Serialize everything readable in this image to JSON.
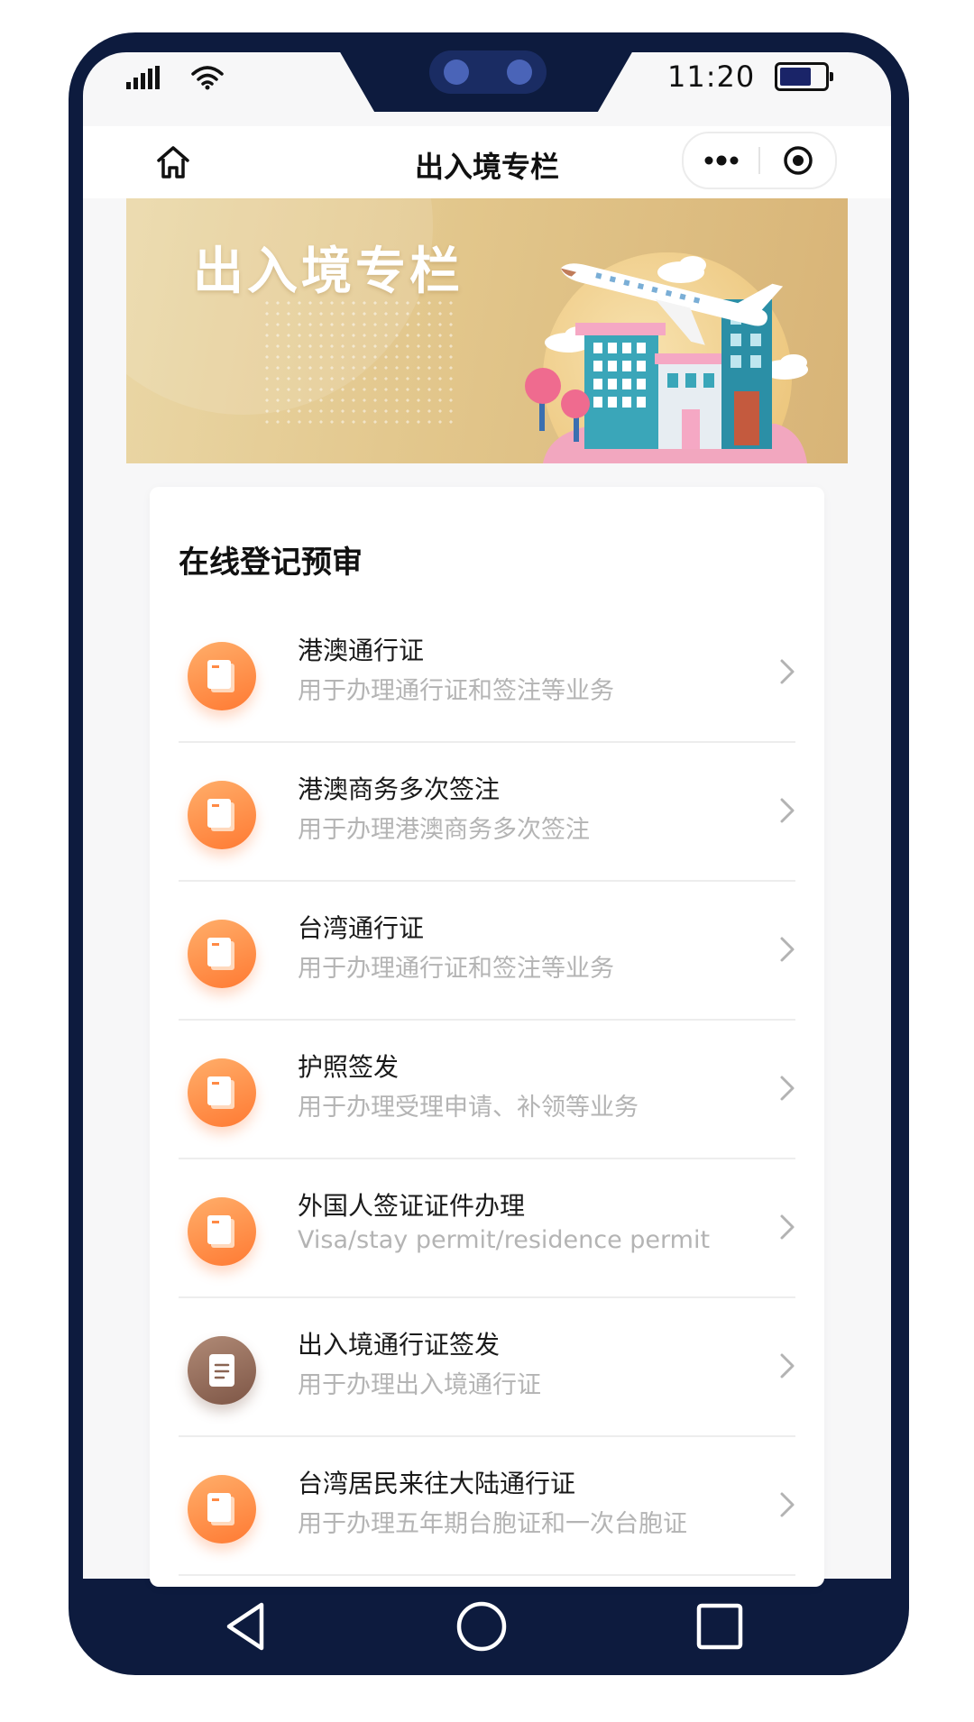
{
  "status_bar": {
    "time": "11:20",
    "icons": [
      "signal-icon",
      "wifi-icon",
      "battery-icon"
    ]
  },
  "navbar": {
    "title": "出入境专栏",
    "icons": [
      "home-icon",
      "more-icon",
      "close-miniprogram-icon"
    ]
  },
  "banner": {
    "title": "出入境专栏",
    "colors": {
      "gold_light": "#ead7a6",
      "gold_dark": "#d8b477"
    }
  },
  "section": {
    "title": "在线登记预审",
    "items": [
      {
        "name": "港澳通行证",
        "desc": "用于办理通行证和签注等业务",
        "icon": "passport-icon"
      },
      {
        "name": "港澳商务多次签注",
        "desc": "用于办理港澳商务多次签注",
        "icon": "passport-icon"
      },
      {
        "name": "台湾通行证",
        "desc": "用于办理通行证和签注等业务",
        "icon": "passport-icon"
      },
      {
        "name": "护照签发",
        "desc": "用于办理受理申请、补领等业务",
        "icon": "passport-icon"
      },
      {
        "name": "外国人签证证件办理",
        "desc": "Visa/stay permit/residence permit",
        "icon": "passport-icon"
      },
      {
        "name": "出入境通行证签发",
        "desc": "用于办理出入境通行证",
        "icon": "document-icon"
      },
      {
        "name": "台湾居民来往大陆通行证",
        "desc": "用于办理五年期台胞证和一次台胞证",
        "icon": "passport-icon"
      }
    ]
  },
  "system_nav": {
    "icons": [
      "back-icon",
      "home-circle-icon",
      "recent-apps-icon"
    ]
  },
  "colors": {
    "accent_orange": "#ff7a33",
    "phone_frame": "#0d1b3e"
  }
}
